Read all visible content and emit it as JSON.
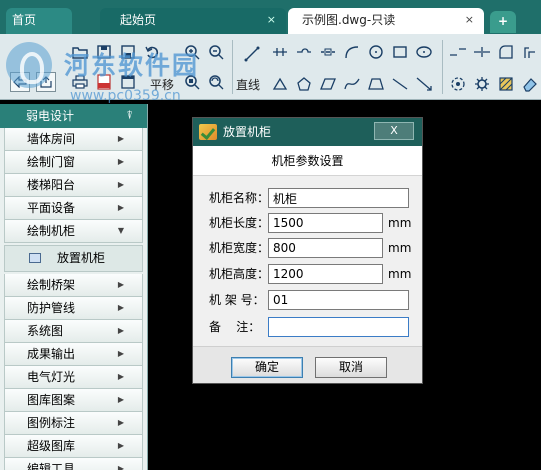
{
  "tabs": {
    "home": "首页",
    "start": "起始页",
    "file": "示例图.dwg-只读",
    "close_glyph": "×",
    "new_glyph": "+"
  },
  "watermark": {
    "text": "河东软件园",
    "url": "www.pc0359.cn"
  },
  "toolbar": {
    "pan_label": "平移",
    "line_label": "直线"
  },
  "sidebar": {
    "header": "弱电设计",
    "items_top": [
      {
        "label": "墙体房间"
      },
      {
        "label": "绘制门窗"
      },
      {
        "label": "楼梯阳台"
      },
      {
        "label": "平面设备"
      },
      {
        "label": "绘制机柜"
      }
    ],
    "sub_item": "放置机柜",
    "items_bottom": [
      {
        "label": "绘制桥架"
      },
      {
        "label": "防护管线"
      },
      {
        "label": "系统图"
      },
      {
        "label": "成果输出"
      },
      {
        "label": "电气灯光"
      },
      {
        "label": "图库图案"
      },
      {
        "label": "图例标注"
      },
      {
        "label": "超级图库"
      },
      {
        "label": "编辑工具"
      }
    ]
  },
  "dialog": {
    "title": "放置机柜",
    "close_label": "X",
    "heading": "机柜参数设置",
    "fields": {
      "name": {
        "label": "机柜名称：",
        "value": "机柜"
      },
      "length": {
        "label": "机柜长度：",
        "value": "1500",
        "unit": "mm"
      },
      "width": {
        "label": "机柜宽度：",
        "value": "800",
        "unit": "mm"
      },
      "height": {
        "label": "机柜高度：",
        "value": "1200",
        "unit": "mm"
      },
      "number": {
        "label": "机 架 号：",
        "value": "01"
      },
      "note": {
        "label": "备    注：",
        "value": ""
      }
    },
    "ok": "确定",
    "cancel": "取消"
  },
  "colors": {
    "accent": "#1e5f5a",
    "tab_bar": "#1f6f6a",
    "canvas": "#000000"
  }
}
